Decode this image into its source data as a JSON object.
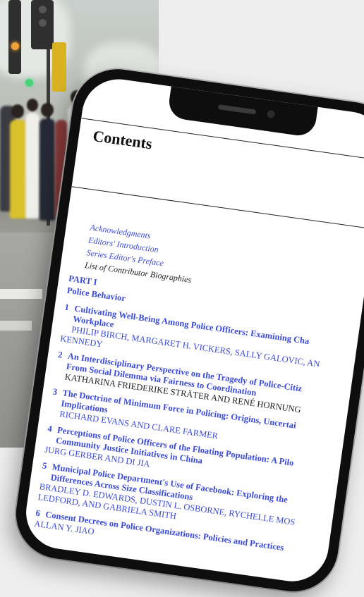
{
  "document": {
    "heading": "Contents",
    "front_matter": [
      {
        "label": "Acknowledgments",
        "linked": true
      },
      {
        "label": "Editors' Introduction",
        "linked": true
      },
      {
        "label": "Series Editor's Preface",
        "linked": true
      },
      {
        "label": "List of Contributor Biographies",
        "linked": false
      }
    ],
    "part": {
      "number": "PART I",
      "title": "Police Behavior"
    },
    "chapters": [
      {
        "number": "1",
        "title_lines": [
          "Cultivating Well-Being Among Police Officers: Examining Cha",
          "Workplace"
        ],
        "author_lines": [
          "PHILIP BIRCH, MARGARET H. VICKERS, SALLY GALOVIC, AN",
          "KENNEDY"
        ],
        "authors_linked": true
      },
      {
        "number": "2",
        "title_lines": [
          "An Interdisciplinary Perspective on the Tragedy of Police-Citiz",
          "From Social Dilemma via Fairness to Coordination"
        ],
        "author_lines": [
          "KATHARINA FRIEDERIKE STRÄTER AND RENÉ HORNUNG"
        ],
        "authors_linked": false
      },
      {
        "number": "3",
        "title_lines": [
          "The Doctrine of Minimum Force in Policing: Origins, Uncertai",
          "Implications"
        ],
        "author_lines": [
          "RICHARD EVANS AND CLARE FARMER"
        ],
        "authors_linked": true
      },
      {
        "number": "4",
        "title_lines": [
          "Perceptions of Police Officers of the Floating Population: A Pilo",
          "Community Justice Initiatives in China"
        ],
        "author_lines": [
          "JURG GERBER AND DI JIA"
        ],
        "authors_linked": true
      },
      {
        "number": "5",
        "title_lines": [
          "Municipal Police Department's Use of Facebook: Exploring the",
          "Differences Across Size Classifications"
        ],
        "author_lines": [
          "BRADLEY D. EDWARDS, DUSTIN L. OSBORNE, RYCHELLE MOS",
          "LEDFORD, AND GABRIELA SMITH"
        ],
        "authors_linked": true
      },
      {
        "number": "6",
        "title_lines": [
          "Consent Decrees on Police Organizations: Policies and Practices"
        ],
        "author_lines": [
          "ALLAN Y. JIAO"
        ],
        "authors_linked": true
      }
    ]
  },
  "colors": {
    "link": "#3b4bd8",
    "text": "#222222",
    "phone_frame": "#0e0e0e",
    "background": "#eeeeee"
  }
}
